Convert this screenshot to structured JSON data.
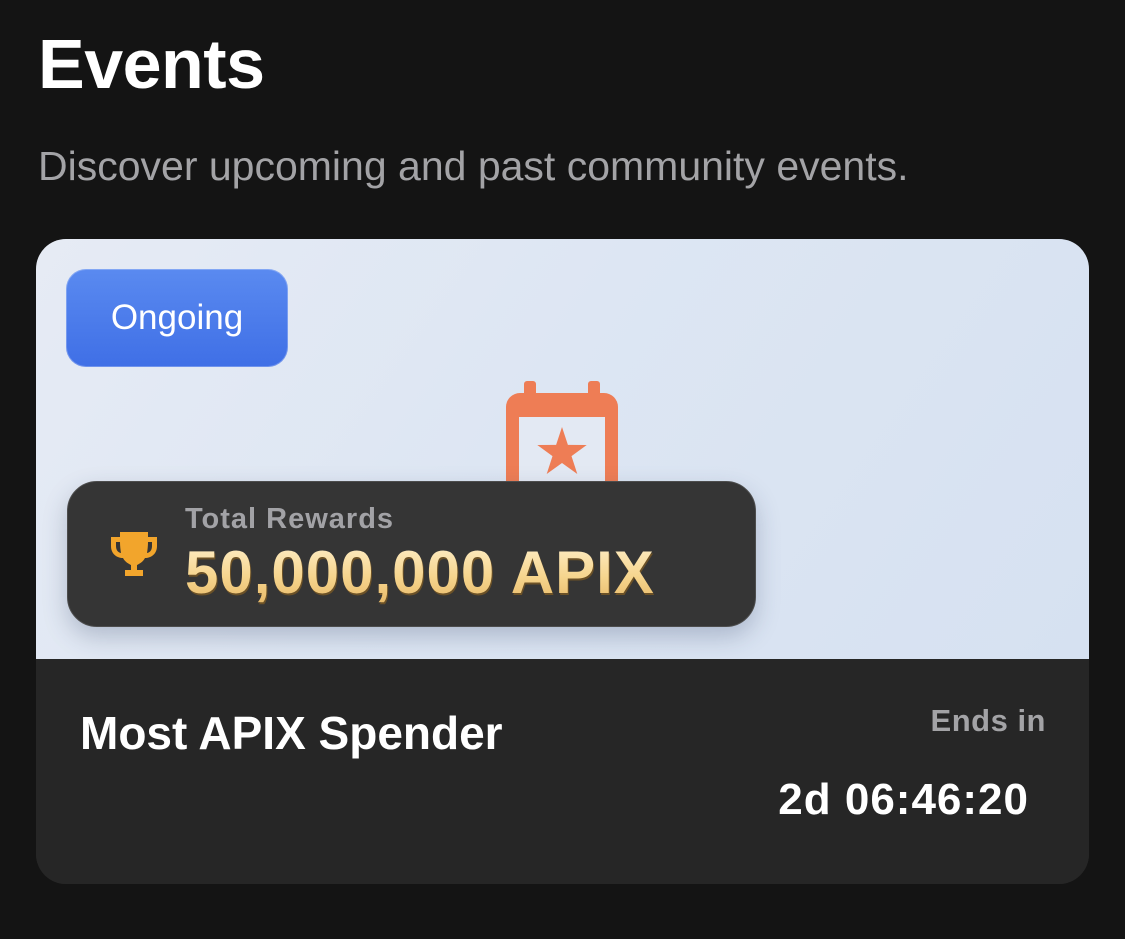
{
  "header": {
    "title": "Events",
    "subtitle": "Discover upcoming and past community events."
  },
  "event_card": {
    "status": "Ongoing",
    "banner_icon": "calendar-star-icon",
    "rewards": {
      "icon": "trophy-icon",
      "label": "Total Rewards",
      "amount": "50,000,000 APIX"
    },
    "name": "Most APIX Spender",
    "ends_label": "Ends in",
    "countdown": "2d 06:46:20"
  },
  "colors": {
    "background": "#141414",
    "card_footer": "#262626",
    "status_badge": "#4a7aeb",
    "calendar_icon": "#ee7d55",
    "trophy_icon": "#f2a52c",
    "rewards_gold": "#f6d58e"
  }
}
